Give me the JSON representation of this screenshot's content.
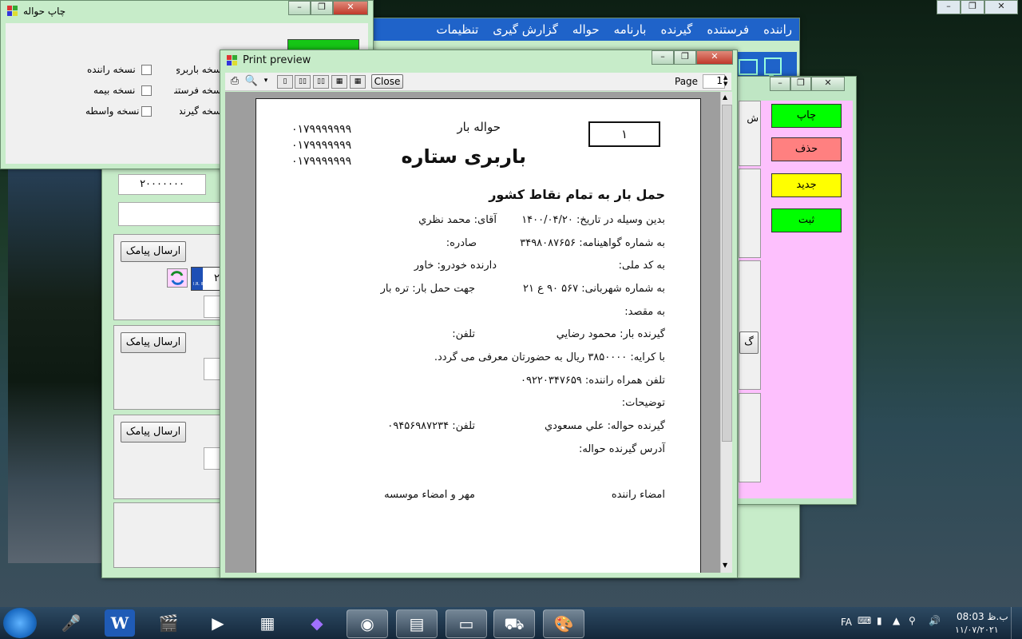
{
  "main_menu": [
    "راننده",
    "فرستنده",
    "گیرنده",
    "بارنامه",
    "حواله",
    "گزارش گیری",
    "تنظیمات"
  ],
  "main_left": {
    "amount_field": "۲۰۰۰۰۰۰۰",
    "sms_label": "ارسال پیامک",
    "plate_digit": "۲",
    "plate_small": "I.R. IRAN"
  },
  "print_dialog": {
    "title": "چاپ حواله",
    "options_right": [
      "نسخه باربری",
      "نسخه فرستنده",
      "نسخه گیرنده"
    ],
    "options_left": [
      "نسخه راننده",
      "نسخه بیمه",
      "نسخه واسطه"
    ]
  },
  "action_window": {
    "buttons": [
      {
        "label": "چاپ",
        "color": "#00ff00"
      },
      {
        "label": "حذف",
        "color": "#ff8080"
      },
      {
        "label": "جدید",
        "color": "#ffff00"
      },
      {
        "label": "ثبت",
        "color": "#00ff00"
      }
    ],
    "fragment_1": "ش",
    "fragment_2": "گ"
  },
  "print_preview": {
    "title": "Print preview",
    "close_label": "Close",
    "page_label": "Page",
    "page_value": "1",
    "doc": {
      "number": "۱",
      "heading": "حواله بار",
      "company": "باربری ستاره",
      "phones": [
        "۰۱۷۹۹۹۹۹۹۹",
        "۰۱۷۹۹۹۹۹۹۹",
        "۰۱۷۹۹۹۹۹۹۹"
      ],
      "slogan": "حمل بار به تمام نقاط کشور",
      "date_line": "بدین وسیله در تاریخ: ۱۴۰۰/۰۴/۲۰",
      "mr": "آقای: محمد نظري",
      "cert": "به شماره گواهینامه: ۳۴۹۸۰۸۷۶۵۶",
      "issued": "صادره:",
      "national_code": "به کد ملی:",
      "vehicle_owner": "دارنده خودرو: خاور",
      "plate": "به شماره شهربانی: ۵۶۷ ۹۰ ع ۲۱",
      "cargo_type": "جهت حمل بار: تره بار",
      "destination": "به مقصد:",
      "receiver": "گیرنده بار: محمود رضايي",
      "receiver_phone": "تلفن:",
      "fee": "با کرایه: ۳۸۵۰۰۰۰ ريال  به حضورتان معرفی می گردد.",
      "driver_mobile": "تلفن همراه راننده: ۰۹۲۲۰۳۴۷۶۵۹",
      "notes": "توضیحات:",
      "voucher_receiver": "گیرنده حواله: علي مسعودي",
      "voucher_phone": "تلفن: ۰۹۴۵۶۹۸۷۲۳۴",
      "voucher_address": "آدرس گیرنده حواله:",
      "driver_sign": "امضاء راننده",
      "company_sign": "مهر و امضاء موسسه"
    }
  },
  "taskbar": {
    "lang": "FA",
    "time": "08:03 ب.ظ",
    "date": "۱۱/۰۷/۲۰۲۱"
  }
}
